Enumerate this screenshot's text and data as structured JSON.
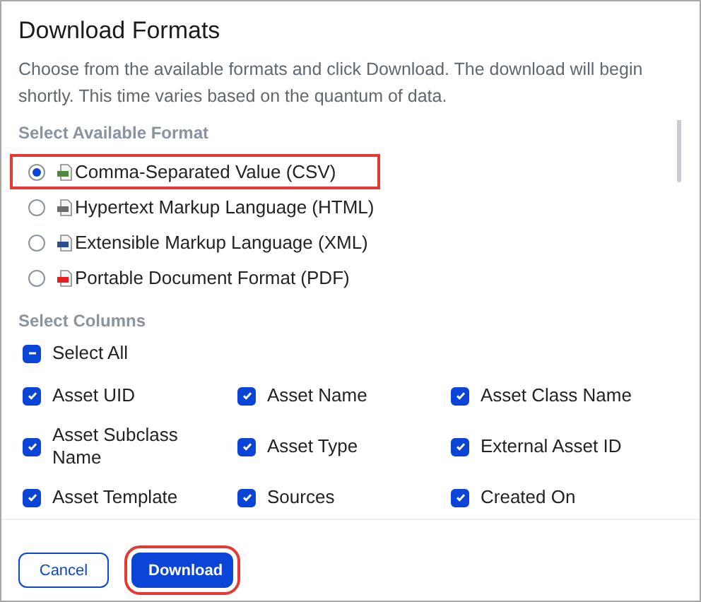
{
  "dialog": {
    "title": "Download Formats",
    "description": "Choose from the available formats and click Download. The download will begin shortly. This time varies based on the quantum of data."
  },
  "format_section": {
    "label": "Select Available Format",
    "formats": [
      {
        "label": "Comma-Separated Value (CSV)",
        "selected": true,
        "highlighted": true,
        "color": "#4e8a3a"
      },
      {
        "label": "Hypertext Markup Language (HTML)",
        "selected": false,
        "highlighted": false,
        "color": "#6b6b6b"
      },
      {
        "label": "Extensible Markup Language (XML)",
        "selected": false,
        "highlighted": false,
        "color": "#2f4f8f"
      },
      {
        "label": "Portable Document Format (PDF)",
        "selected": false,
        "highlighted": false,
        "color": "#e02020"
      }
    ]
  },
  "columns_section": {
    "label": "Select Columns",
    "select_all": {
      "label": "Select All",
      "checked": false,
      "indeterminate": true
    },
    "columns": [
      {
        "label": "Asset UID",
        "checked": true
      },
      {
        "label": "Asset Name",
        "checked": true
      },
      {
        "label": "Asset Class Name",
        "checked": true
      },
      {
        "label": "Asset Subclass Name",
        "checked": true
      },
      {
        "label": "Asset Type",
        "checked": true
      },
      {
        "label": "External Asset ID",
        "checked": true
      },
      {
        "label": "Asset Template",
        "checked": true
      },
      {
        "label": "Sources",
        "checked": true
      },
      {
        "label": "Created On",
        "checked": true
      }
    ]
  },
  "buttons": [
    {
      "label": "Cancel",
      "kind": "secondary",
      "highlighted": false
    },
    {
      "label": "Download",
      "kind": "primary",
      "highlighted": true
    }
  ]
}
